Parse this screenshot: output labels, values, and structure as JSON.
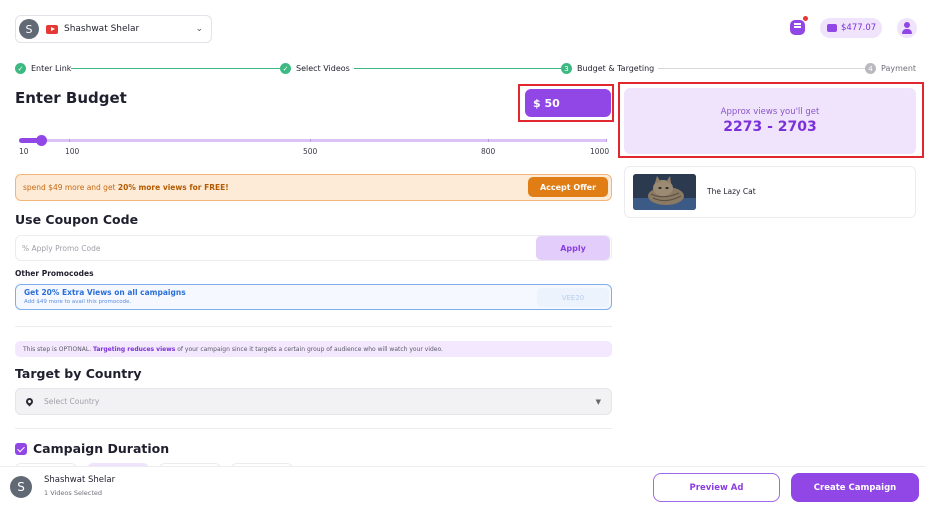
{
  "header": {
    "channel": {
      "avatar_letter": "S",
      "name": "Shashwat Shelar",
      "icon": "youtube-icon"
    },
    "balance": "$477.07",
    "colors": {
      "accent": "#9146e6",
      "success": "#3fb983",
      "offer": "#e07d14",
      "notification": "#e53935"
    }
  },
  "steps": [
    {
      "label": "Enter Link",
      "state": "done",
      "num": ""
    },
    {
      "label": "Select Videos",
      "state": "done",
      "num": ""
    },
    {
      "label": "Budget & Targeting",
      "state": "current",
      "num": "3"
    },
    {
      "label": "Payment",
      "state": "pending",
      "num": "4"
    }
  ],
  "budget": {
    "heading": "Enter Budget",
    "value": "$ 50",
    "slider": {
      "min": 10,
      "max": 1000,
      "value": 50,
      "ticks": [
        "10",
        "100",
        "500",
        "800",
        "1000"
      ]
    }
  },
  "views": {
    "label": "Approx views you'll get",
    "range": "2273 - 2703"
  },
  "offer": {
    "text_prefix": "spend $49 more and get ",
    "text_bold": "20% more views for FREE!",
    "button": "Accept Offer"
  },
  "video": {
    "title": "The Lazy Cat"
  },
  "coupon": {
    "heading": "Use Coupon Code",
    "placeholder": "% Apply Promo Code",
    "apply": "Apply",
    "other_label": "Other Promocodes",
    "promo": {
      "title": "Get 20% Extra Views on all campaigns",
      "subtitle": "Add $49 more to avail this promocode.",
      "code": "VEE20"
    }
  },
  "targeting": {
    "note_prefix": "This step is OPTIONAL. ",
    "note_bold": "Targeting reduces views",
    "note_suffix": " of your campaign since it targets a certain group of audience who will watch your video.",
    "heading": "Target by Country",
    "placeholder": "Select Country"
  },
  "duration": {
    "heading": "Campaign Duration",
    "checked": true
  },
  "footer": {
    "avatar_letter": "S",
    "name": "Shashwat Shelar",
    "subtitle": "1 Videos Selected",
    "preview": "Preview Ad",
    "create": "Create Campaign"
  }
}
